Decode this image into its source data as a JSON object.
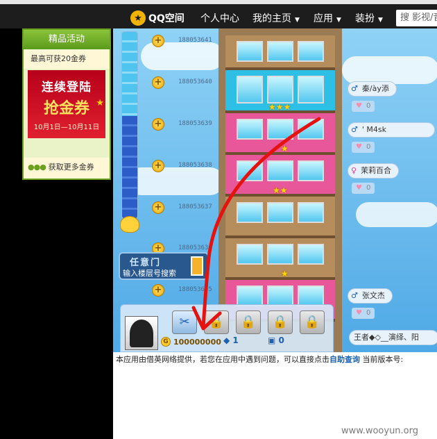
{
  "topbar": {
    "brand": "QQ空间",
    "nav": [
      "个人中心",
      "我的主页",
      "应用",
      "装扮"
    ],
    "nav_has_caret": [
      false,
      true,
      true,
      true
    ],
    "search_placeholder": "搜 影视/音"
  },
  "promo": {
    "title": "精品活动",
    "subtitle": "最高可获20金券",
    "banner_line1": "连续登陆",
    "banner_line2": "抢金券",
    "banner_dates": "10月1日—10月11日",
    "more_link": "获取更多金券"
  },
  "game": {
    "level_fill_percent": 55,
    "floors": [
      "188053641",
      "188053640",
      "188053639",
      "188053638",
      "188053637",
      "188053636",
      "188053635"
    ],
    "players": [
      {
        "sex": "♂",
        "name": "秦/ày添",
        "likes": "0"
      },
      {
        "sex": "♂",
        "name": "'          M4sk",
        "likes": "0"
      },
      {
        "sex": "♀",
        "name": "茉莉百合",
        "likes": "0"
      },
      {
        "sex": "♂",
        "name": "张文杰",
        "likes": "0"
      }
    ],
    "friend_search": "王者◆◇__演绎、阳",
    "portal_title": "任意门",
    "portal_hint": "输入楼层号搜索",
    "gold": "100000000",
    "gems": "1",
    "tickets": "0",
    "gold_symbol": "G",
    "gem_symbol": "◆",
    "ticket_symbol": "▣"
  },
  "footer": {
    "text_before": "本应用由借英网络提供，若您在应用中遇到问题，可以直接点击",
    "link": "自助查询",
    "text_after": "  当前版本号:"
  },
  "watermark": "www.wooyun.org",
  "colors": {
    "accent_green": "#6a9f1f",
    "banner_red": "#c4001c",
    "arrow_red": "#e5130f",
    "topbar": "#1d1d1d"
  }
}
